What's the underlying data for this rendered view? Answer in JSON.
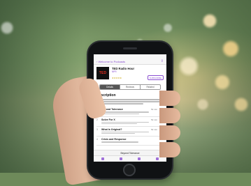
{
  "scene": {
    "description_colors": {
      "foliage": "#5f7b52",
      "bokeh": "#ffe2a8",
      "skin": "#e0b79c",
      "phone": "#101214"
    },
    "bokeh": [
      {
        "c": "#ffe7b8",
        "o": 0.85
      },
      {
        "c": "#ffd98f",
        "o": 0.8
      },
      {
        "c": "#fff1d0",
        "o": 0.75
      },
      {
        "c": "#ffe3a3",
        "o": 0.7
      },
      {
        "c": "#ffffff",
        "o": 0.55
      },
      {
        "c": "#f6e6c2",
        "o": 0.6
      },
      {
        "c": "#ffe0a0",
        "o": 0.65
      },
      {
        "c": "#ffffff",
        "o": 0.5
      },
      {
        "c": "#e9f1dc",
        "o": 0.45
      }
    ]
  },
  "app": {
    "back_label": "‹ Welcome to Podcasts",
    "share_icon": "share-icon",
    "accent_color": "#8a4fd1",
    "artwork_text": "TED",
    "podcast_title": "TED Radio Hour",
    "podcast_author": "NPR",
    "rating": "★★★★★",
    "subscribe_label": "SUBSCRIBE",
    "tabs": [
      "Details",
      "Reviews",
      "Related"
    ],
    "description_heading": "Description",
    "episodes": [
      {
        "num": "1",
        "title": "Beyond Tolerance",
        "duration": "52 min"
      },
      {
        "num": "2",
        "title": "Solve For X",
        "duration": "52 min"
      },
      {
        "num": "3",
        "title": "What Is Original?",
        "duration": "52 min"
      },
      {
        "num": "4",
        "title": "Crisis and Response",
        "duration": ""
      }
    ],
    "now_playing": "Beyond Tolerance"
  }
}
